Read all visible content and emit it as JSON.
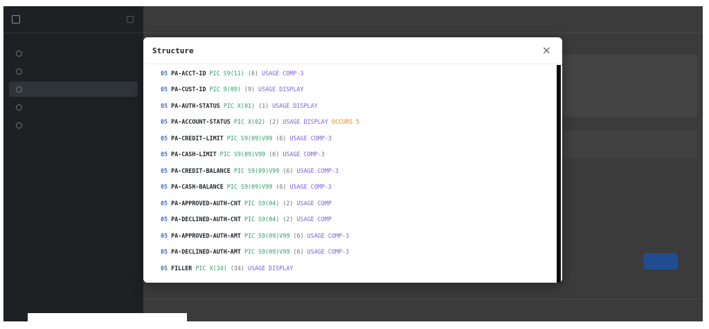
{
  "modal": {
    "title": "Structure",
    "close_glyph": "×",
    "rows": [
      {
        "level": "05",
        "name": "PA-ACCT-ID",
        "pic": "PIC S9(11)",
        "size": "(6)",
        "usage": "USAGE COMP-3",
        "occurs": ""
      },
      {
        "level": "05",
        "name": "PA-CUST-ID",
        "pic": "PIC 9(09)",
        "size": "(9)",
        "usage": "USAGE DISPLAY",
        "occurs": ""
      },
      {
        "level": "05",
        "name": "PA-AUTH-STATUS",
        "pic": "PIC X(01)",
        "size": "(1)",
        "usage": "USAGE DISPLAY",
        "occurs": ""
      },
      {
        "level": "05",
        "name": "PA-ACCOUNT-STATUS",
        "pic": "PIC X(02)",
        "size": "(2)",
        "usage": "USAGE DISPLAY",
        "occurs": "OCCURS 5"
      },
      {
        "level": "05",
        "name": "PA-CREDIT-LIMIT",
        "pic": "PIC S9(09)V99",
        "size": "(6)",
        "usage": "USAGE COMP-3",
        "occurs": ""
      },
      {
        "level": "05",
        "name": "PA-CASH-LIMIT",
        "pic": "PIC S9(09)V99",
        "size": "(6)",
        "usage": "USAGE COMP-3",
        "occurs": ""
      },
      {
        "level": "05",
        "name": "PA-CREDIT-BALANCE",
        "pic": "PIC S9(09)V99",
        "size": "(6)",
        "usage": "USAGE COMP-3",
        "occurs": ""
      },
      {
        "level": "05",
        "name": "PA-CASH-BALANCE",
        "pic": "PIC S9(09)V99",
        "size": "(6)",
        "usage": "USAGE COMP-3",
        "occurs": ""
      },
      {
        "level": "05",
        "name": "PA-APPROVED-AUTH-CNT",
        "pic": "PIC S9(04)",
        "size": "(2)",
        "usage": "USAGE COMP",
        "occurs": ""
      },
      {
        "level": "05",
        "name": "PA-DECLINED-AUTH-CNT",
        "pic": "PIC S9(04)",
        "size": "(2)",
        "usage": "USAGE COMP",
        "occurs": ""
      },
      {
        "level": "05",
        "name": "PA-APPROVED-AUTH-AMT",
        "pic": "PIC S9(09)V99",
        "size": "(6)",
        "usage": "USAGE COMP-3",
        "occurs": ""
      },
      {
        "level": "05",
        "name": "PA-DECLINED-AUTH-AMT",
        "pic": "PIC S9(09)V99",
        "size": "(6)",
        "usage": "USAGE COMP-3",
        "occurs": ""
      },
      {
        "level": "05",
        "name": "FILLER",
        "pic": "PIC X(34)",
        "size": "(34)",
        "usage": "USAGE DISPLAY",
        "occurs": ""
      }
    ]
  },
  "colors": {
    "level": "#3b6fd0",
    "name": "#1f2428",
    "pic": "#2e9a6a",
    "size": "#6a6f74",
    "usage": "#7b5fd6",
    "occurs": "#e08a1e"
  },
  "icons": {
    "close": "close-icon",
    "sidebar_logo": "logo-icon",
    "collapse": "sidebar-collapse-icon"
  }
}
